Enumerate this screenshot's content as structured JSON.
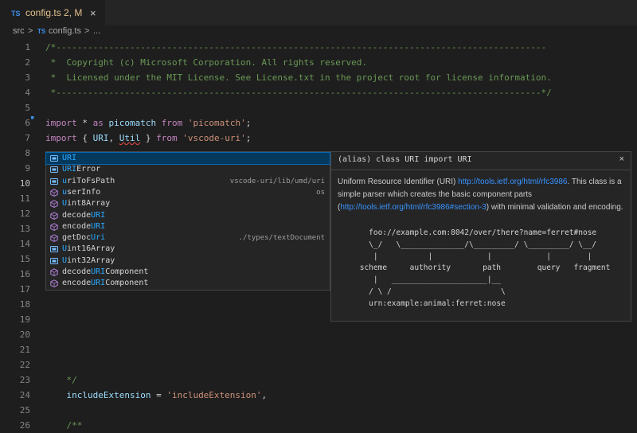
{
  "tab": {
    "lang": "TS",
    "name": "config.ts",
    "badge": "2, M",
    "close": "×"
  },
  "breadcrumb": {
    "folder": "src",
    "sep1": ">",
    "lang": "TS",
    "file": "config.ts",
    "sep2": ">",
    "more": "..."
  },
  "code_lines": [
    {
      "n": "1",
      "segs": [
        {
          "c": "com",
          "t": "/*---------------------------------------------------------------------------------------------"
        }
      ]
    },
    {
      "n": "2",
      "segs": [
        {
          "c": "com",
          "t": " *  Copyright (c) Microsoft Corporation. All rights reserved."
        }
      ]
    },
    {
      "n": "3",
      "segs": [
        {
          "c": "com",
          "t": " *  Licensed under the MIT License. See License.txt in the project root for license information."
        }
      ]
    },
    {
      "n": "4",
      "segs": [
        {
          "c": "com",
          "t": " *--------------------------------------------------------------------------------------------*/"
        }
      ]
    },
    {
      "n": "5",
      "segs": []
    },
    {
      "n": "6",
      "segs": [
        {
          "c": "kw",
          "t": "import"
        },
        {
          "c": "op",
          "t": " * "
        },
        {
          "c": "kw",
          "t": "as"
        },
        {
          "c": "op",
          "t": " "
        },
        {
          "c": "id",
          "t": "picomatch"
        },
        {
          "c": "op",
          "t": " "
        },
        {
          "c": "kw",
          "t": "from"
        },
        {
          "c": "op",
          "t": " "
        },
        {
          "c": "str",
          "t": "'picomatch'"
        },
        {
          "c": "op",
          "t": ";"
        }
      ]
    },
    {
      "n": "7",
      "segs": [
        {
          "c": "kw",
          "t": "import"
        },
        {
          "c": "op",
          "t": " { "
        },
        {
          "c": "id",
          "t": "URI"
        },
        {
          "c": "op",
          "t": ", "
        },
        {
          "c": "idsq",
          "t": "Util"
        },
        {
          "c": "op",
          "t": " } "
        },
        {
          "c": "kw",
          "t": "from"
        },
        {
          "c": "op",
          "t": " "
        },
        {
          "c": "str",
          "t": "'vscode-uri'"
        },
        {
          "c": "op",
          "t": ";"
        }
      ]
    },
    {
      "n": "8",
      "segs": []
    },
    {
      "n": "9",
      "segs": []
    },
    {
      "n": "10",
      "active": true,
      "segs": [
        {
          "c": "id",
          "t": "URI"
        }
      ]
    },
    {
      "n": "11",
      "segs": []
    },
    {
      "n": "12",
      "segs": [
        {
          "c": "com",
          "t": "/**"
        }
      ]
    },
    {
      "n": "13",
      "segs": [
        {
          "c": "com",
          "t": " *"
        }
      ]
    },
    {
      "n": "14",
      "segs": [
        {
          "c": "com",
          "t": " */"
        }
      ]
    },
    {
      "n": "15",
      "segs": [
        {
          "c": "kw",
          "t": "exp"
        }
      ]
    },
    {
      "n": "16",
      "segs": []
    },
    {
      "n": "17",
      "segs": []
    },
    {
      "n": "18",
      "segs": []
    },
    {
      "n": "19",
      "segs": []
    },
    {
      "n": "20",
      "segs": []
    },
    {
      "n": "21",
      "segs": []
    },
    {
      "n": "22",
      "segs": []
    },
    {
      "n": "23",
      "segs": [
        {
          "c": "com",
          "t": "    */"
        }
      ]
    },
    {
      "n": "24",
      "segs": [
        {
          "c": "id",
          "t": "    includeExtension"
        },
        {
          "c": "op",
          "t": " = "
        },
        {
          "c": "str",
          "t": "'includeExtension'"
        },
        {
          "c": "op",
          "t": ","
        }
      ]
    },
    {
      "n": "25",
      "segs": []
    },
    {
      "n": "26",
      "segs": [
        {
          "c": "com",
          "t": "    /**"
        }
      ]
    }
  ],
  "suggestions": [
    {
      "pre": "",
      "match": "URI",
      "post": "",
      "detail": "",
      "icon": "alias",
      "selected": true
    },
    {
      "pre": "",
      "match": "URI",
      "post": "Error",
      "detail": "",
      "icon": "alias"
    },
    {
      "pre": "",
      "match": "u",
      "post": "riToFsPath",
      "detail": "vscode-uri/lib/umd/uri",
      "icon": "alias"
    },
    {
      "pre": "",
      "match": "u",
      "post": "serInfo",
      "detail": "os",
      "icon": "module"
    },
    {
      "pre": "",
      "match": "U",
      "post": "int8Array",
      "detail": "",
      "icon": "module"
    },
    {
      "pre": "decode",
      "match": "URI",
      "post": "",
      "detail": "",
      "icon": "module"
    },
    {
      "pre": "encode",
      "match": "URI",
      "post": "",
      "detail": "",
      "icon": "module"
    },
    {
      "pre": "getDoc",
      "match": "Uri",
      "post": "",
      "detail": "./types/textDocument",
      "icon": "module"
    },
    {
      "pre": "",
      "match": "U",
      "post": "int16Array",
      "detail": "",
      "icon": "alias"
    },
    {
      "pre": "",
      "match": "U",
      "post": "int32Array",
      "detail": "",
      "icon": "alias"
    },
    {
      "pre": "decode",
      "match": "URI",
      "post": "Component",
      "detail": "",
      "icon": "module"
    },
    {
      "pre": "encode",
      "match": "URI",
      "post": "Component",
      "detail": "",
      "icon": "module"
    }
  ],
  "doc": {
    "signature": "(alias) class URI import URI",
    "close": "×",
    "desc_a": "Uniform Resource Identifier (URI) ",
    "link1": "http://tools.ietf.org/html/rfc3986",
    "desc_b": ". This class is a simple parser which creates the basic component parts (",
    "link2": "http://tools.ietf.org/html/rfc3986#section-3",
    "desc_c": ") with minimal validation and encoding.",
    "diagram": "   foo://example.com:8042/over/there?name=ferret#nose\n   \\_/   \\______________/\\_________/ \\_________/ \\__/\n    |           |            |            |        |\n scheme     authority       path        query   fragment\n    |   _____________________|__\n   / \\ /                        \\\n   urn:example:animal:ferret:nose"
  }
}
